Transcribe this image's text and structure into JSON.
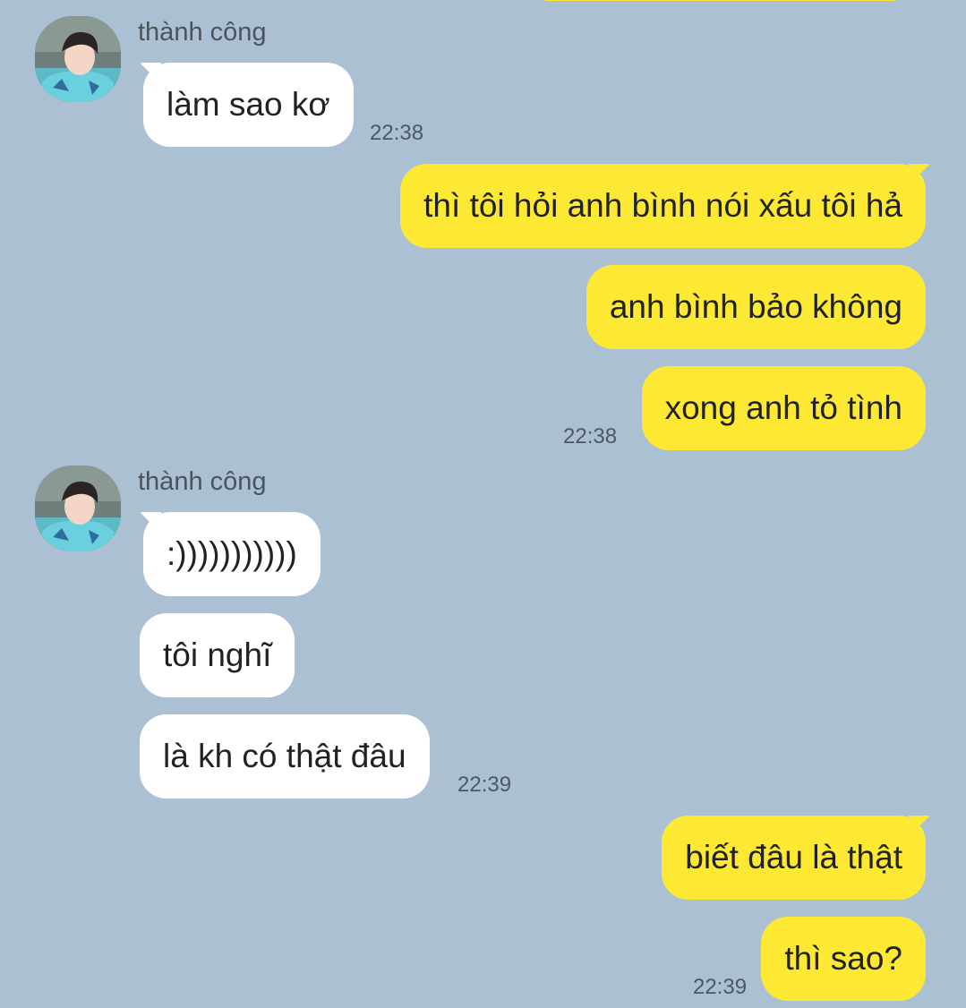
{
  "colors": {
    "background": "#abc1d3",
    "incoming_bubble": "#ffffff",
    "outgoing_bubble": "#fde934",
    "sender_name": "#4b535b",
    "timestamp": "#4e5862"
  },
  "conversation": {
    "groups": [
      {
        "sender": "thành công",
        "avatar": "contact-avatar",
        "messages": [
          "làm sao kơ"
        ],
        "time": "22:38"
      },
      {
        "sender": "me",
        "messages": [
          "thì tôi hỏi anh bình nói xấu tôi hả",
          "anh bình bảo không",
          "xong anh tỏ tình"
        ],
        "time": "22:38"
      },
      {
        "sender": "thành công",
        "avatar": "contact-avatar",
        "messages": [
          ":)))))))))))",
          "tôi nghĩ",
          "là kh có thật đâu"
        ],
        "time": "22:39"
      },
      {
        "sender": "me",
        "messages": [
          "biết đâu là thật",
          "thì sao?"
        ],
        "time": "22:39"
      }
    ]
  }
}
